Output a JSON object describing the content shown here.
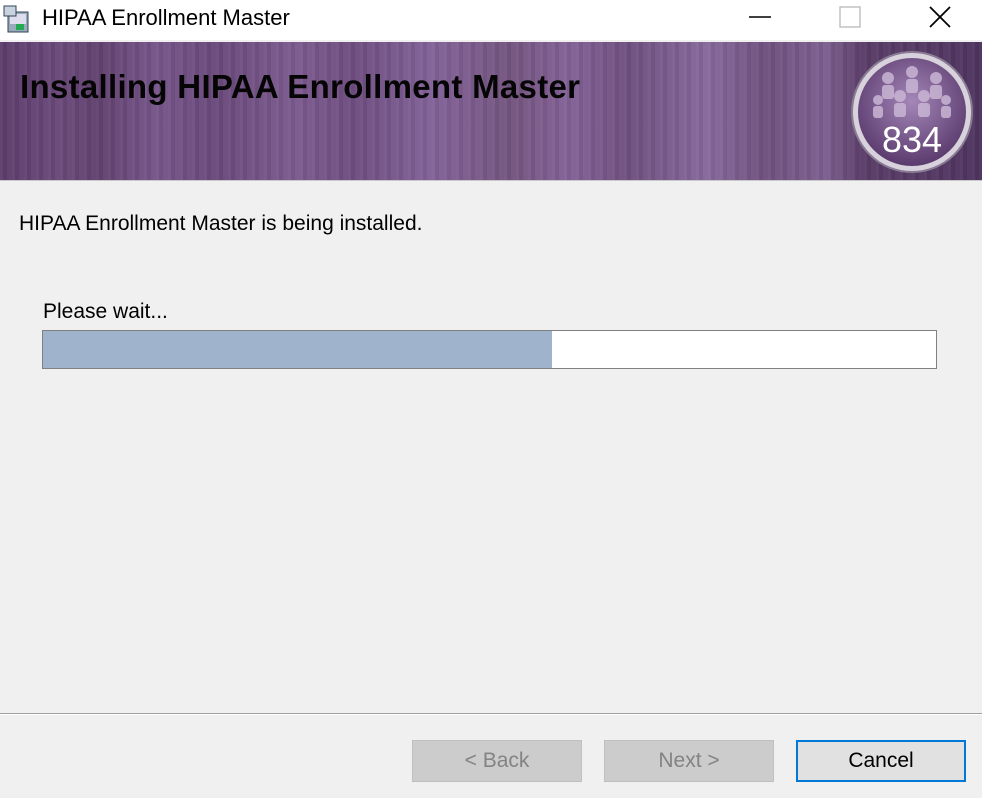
{
  "window": {
    "title": "HIPAA Enrollment Master",
    "controls": {
      "minimize": "minimize-icon",
      "maximize": "maximize-icon",
      "close": "close-icon"
    }
  },
  "banner": {
    "heading": "Installing HIPAA Enrollment Master",
    "logo_number": "834",
    "accent_color": "#6e4d80"
  },
  "main": {
    "status": "HIPAA Enrollment Master is being installed.",
    "wait_label": "Please wait...",
    "progress_fraction": 0.57,
    "progress_color": "#9fb3cd"
  },
  "buttons": {
    "back": "< Back",
    "next": "Next >",
    "cancel": "Cancel"
  }
}
